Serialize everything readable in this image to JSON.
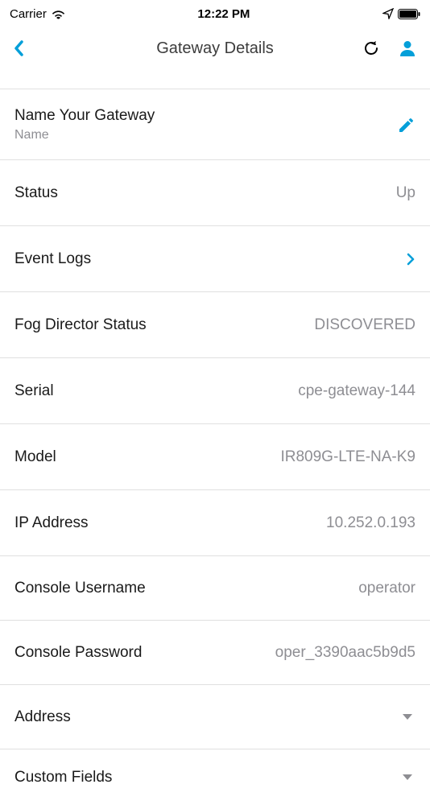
{
  "statusbar": {
    "carrier": "Carrier",
    "time": "12:22 PM"
  },
  "nav": {
    "title": "Gateway Details"
  },
  "rows": {
    "gateway_name_label": "Name Your Gateway",
    "gateway_name_sub": "Name",
    "status_label": "Status",
    "status_value": "Up",
    "event_logs_label": "Event Logs",
    "fog_label": "Fog Director Status",
    "fog_value": "DISCOVERED",
    "serial_label": "Serial",
    "serial_value": "cpe-gateway-144",
    "model_label": "Model",
    "model_value": "IR809G-LTE-NA-K9",
    "ip_label": "IP Address",
    "ip_value": "10.252.0.193",
    "console_user_label": "Console Username",
    "console_user_value": "operator",
    "console_pass_label": "Console Password",
    "console_pass_value": "oper_3390aac5b9d5",
    "address_label": "Address",
    "custom_fields_label": "Custom Fields"
  }
}
